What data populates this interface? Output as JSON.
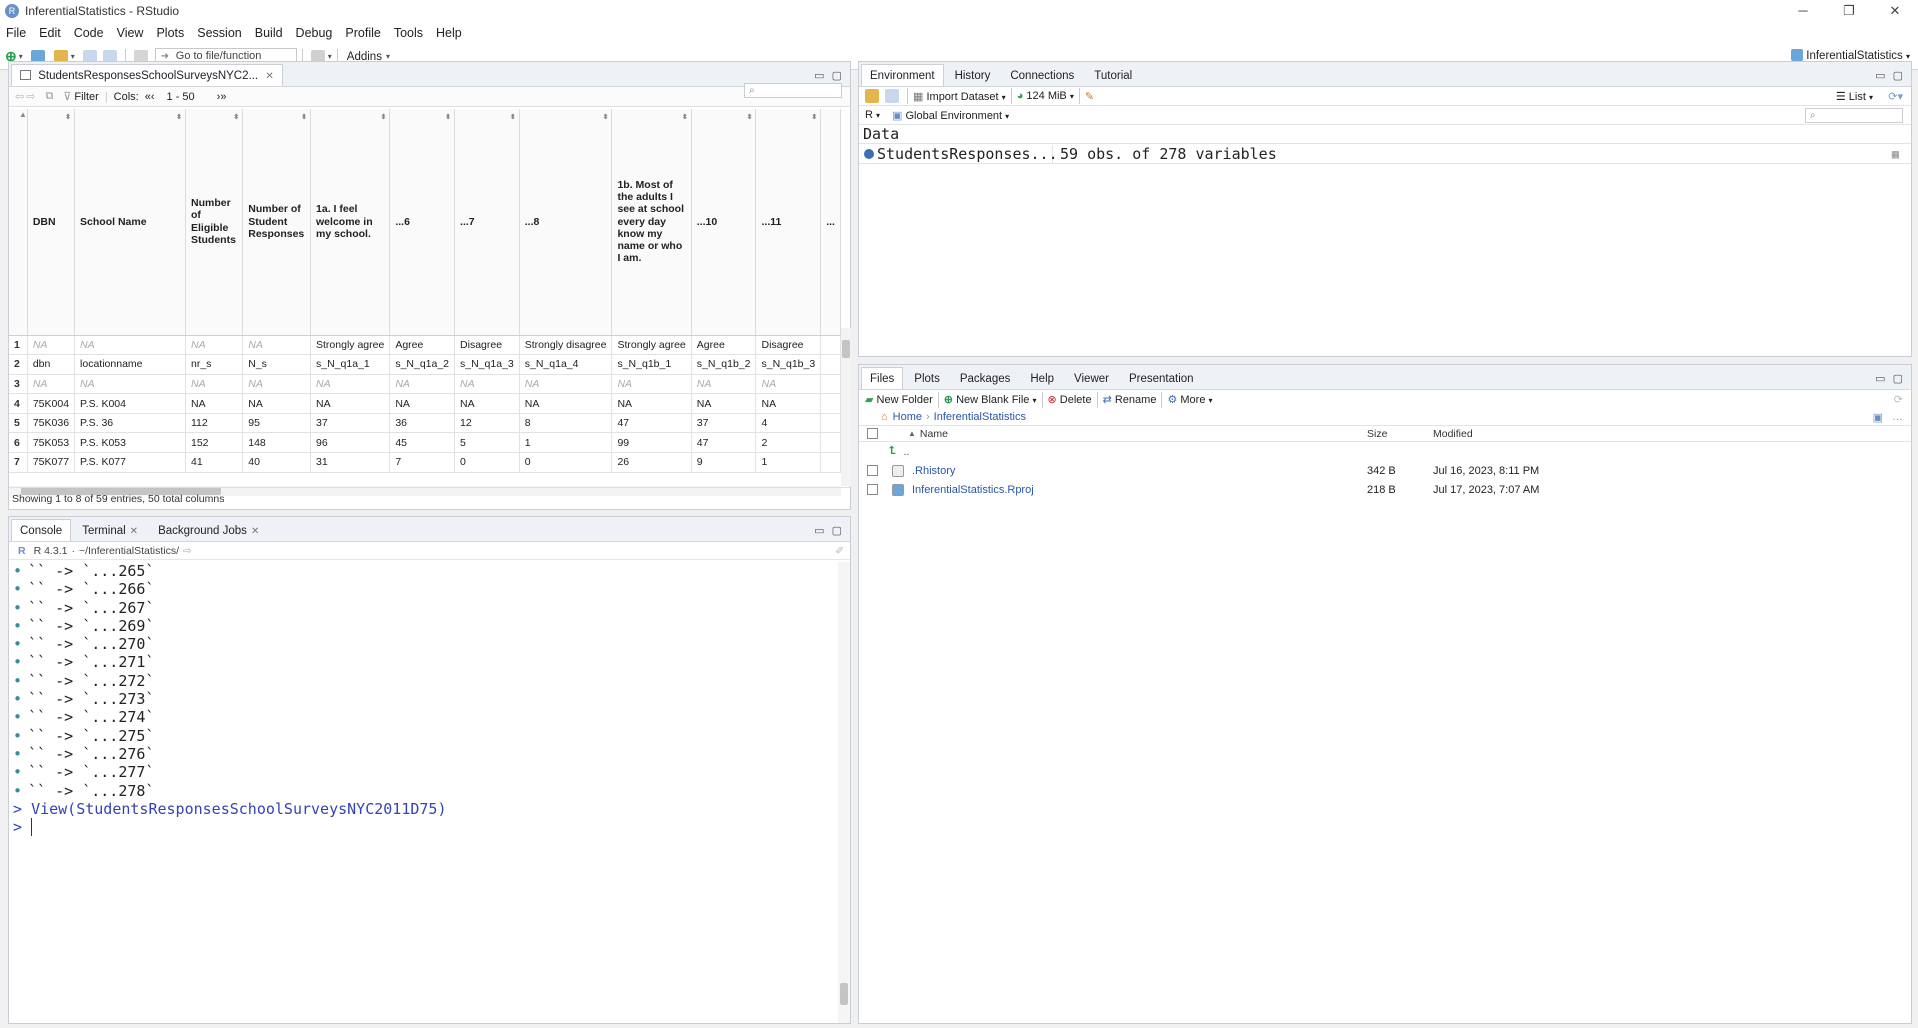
{
  "window": {
    "title": "InferentialStatistics - RStudio",
    "app_icon_letter": "R"
  },
  "menu": [
    "File",
    "Edit",
    "Code",
    "View",
    "Plots",
    "Session",
    "Build",
    "Debug",
    "Profile",
    "Tools",
    "Help"
  ],
  "toolbar": {
    "goto_label": "Go to file/function",
    "addins_label": "Addins",
    "project_label": "InferentialStatistics"
  },
  "viewer": {
    "tab_label": "StudentsResponsesSchoolSurveysNYC2...",
    "filter_label": "Filter",
    "cols_label": "Cols:",
    "cols_range": "1 - 50",
    "headers": [
      "DBN",
      "School Name",
      "Number of Eligible Students",
      "Number of Student Responses",
      "1a. I feel welcome in my school.",
      "...6",
      "...7",
      "...8",
      "1b. Most of the adults I see at school every day know my name or who I am.",
      "...10",
      "...11",
      "..."
    ],
    "rows": [
      {
        "n": "1",
        "cells": [
          "NA",
          "NA",
          "NA",
          "NA",
          "Strongly agree",
          "Agree",
          "Disagree",
          "Strongly disagree",
          "Strongly agree",
          "Agree",
          "Disagree"
        ],
        "na": [
          true,
          true,
          true,
          true,
          false,
          false,
          false,
          false,
          false,
          false,
          false
        ]
      },
      {
        "n": "2",
        "cells": [
          "dbn",
          "locationname",
          "nr_s",
          "N_s",
          "s_N_q1a_1",
          "s_N_q1a_2",
          "s_N_q1a_3",
          "s_N_q1a_4",
          "s_N_q1b_1",
          "s_N_q1b_2",
          "s_N_q1b_3"
        ],
        "na": [
          false,
          false,
          false,
          false,
          false,
          false,
          false,
          false,
          false,
          false,
          false
        ]
      },
      {
        "n": "3",
        "cells": [
          "NA",
          "NA",
          "NA",
          "NA",
          "NA",
          "NA",
          "NA",
          "NA",
          "NA",
          "NA",
          "NA"
        ],
        "na": [
          true,
          true,
          true,
          true,
          true,
          true,
          true,
          true,
          true,
          true,
          true
        ]
      },
      {
        "n": "4",
        "cells": [
          "75K004",
          "P.S. K004",
          "NA",
          "NA",
          "NA",
          "NA",
          "NA",
          "NA",
          "NA",
          "NA",
          "NA"
        ],
        "na": [
          false,
          false,
          false,
          false,
          false,
          false,
          false,
          false,
          false,
          false,
          false
        ]
      },
      {
        "n": "5",
        "cells": [
          "75K036",
          "P.S. 36",
          "112",
          "95",
          "37",
          "36",
          "12",
          "8",
          "47",
          "37",
          "4"
        ],
        "na": [
          false,
          false,
          false,
          false,
          false,
          false,
          false,
          false,
          false,
          false,
          false
        ]
      },
      {
        "n": "6",
        "cells": [
          "75K053",
          "P.S. K053",
          "152",
          "148",
          "96",
          "45",
          "5",
          "1",
          "99",
          "47",
          "2"
        ],
        "na": [
          false,
          false,
          false,
          false,
          false,
          false,
          false,
          false,
          false,
          false,
          false
        ]
      },
      {
        "n": "7",
        "cells": [
          "75K077",
          "P.S. K077",
          "41",
          "40",
          "31",
          "7",
          "0",
          "0",
          "26",
          "9",
          "1"
        ],
        "na": [
          false,
          false,
          false,
          false,
          false,
          false,
          false,
          false,
          false,
          false,
          false
        ]
      }
    ],
    "status": "Showing 1 to 8 of 59 entries, 50 total columns"
  },
  "console": {
    "tabs": [
      "Console",
      "Terminal",
      "Background Jobs"
    ],
    "version": "R 4.3.1",
    "path": "~/InferentialStatistics/",
    "lines": [
      "`` -> `...265`",
      "`` -> `...266`",
      "`` -> `...267`",
      "`` -> `...269`",
      "`` -> `...270`",
      "`` -> `...271`",
      "`` -> `...272`",
      "`` -> `...273`",
      "`` -> `...274`",
      "`` -> `...275`",
      "`` -> `...276`",
      "`` -> `...277`",
      "`` -> `...278`"
    ],
    "command_prompt": ">",
    "command": "View(StudentsResponsesSchoolSurveysNYC2011D75)",
    "input_prompt": ">"
  },
  "environment": {
    "tabs": [
      "Environment",
      "History",
      "Connections",
      "Tutorial"
    ],
    "import_label": "Import Dataset",
    "memory_label": "124 MiB",
    "view_mode": "List",
    "lang": "R",
    "scope": "Global Environment",
    "section": "Data",
    "object_name": "StudentsResponses...",
    "object_desc": "59 obs. of 278 variables"
  },
  "files": {
    "tabs": [
      "Files",
      "Plots",
      "Packages",
      "Help",
      "Viewer",
      "Presentation"
    ],
    "new_folder": "New Folder",
    "new_blank": "New Blank File",
    "delete": "Delete",
    "rename": "Rename",
    "more": "More",
    "crumb_home": "Home",
    "crumb_dir": "InferentialStatistics",
    "col_name": "Name",
    "col_size": "Size",
    "col_modified": "Modified",
    "up": "..",
    "items": [
      {
        "name": ".Rhistory",
        "size": "342 B",
        "modified": "Jul 16, 2023, 8:11 PM"
      },
      {
        "name": "InferentialStatistics.Rproj",
        "size": "218 B",
        "modified": "Jul 17, 2023, 7:07 AM"
      }
    ]
  },
  "colors": {
    "accent": "#2a56a8",
    "prompt": "#3343b5",
    "bullet": "#3a8d96"
  }
}
